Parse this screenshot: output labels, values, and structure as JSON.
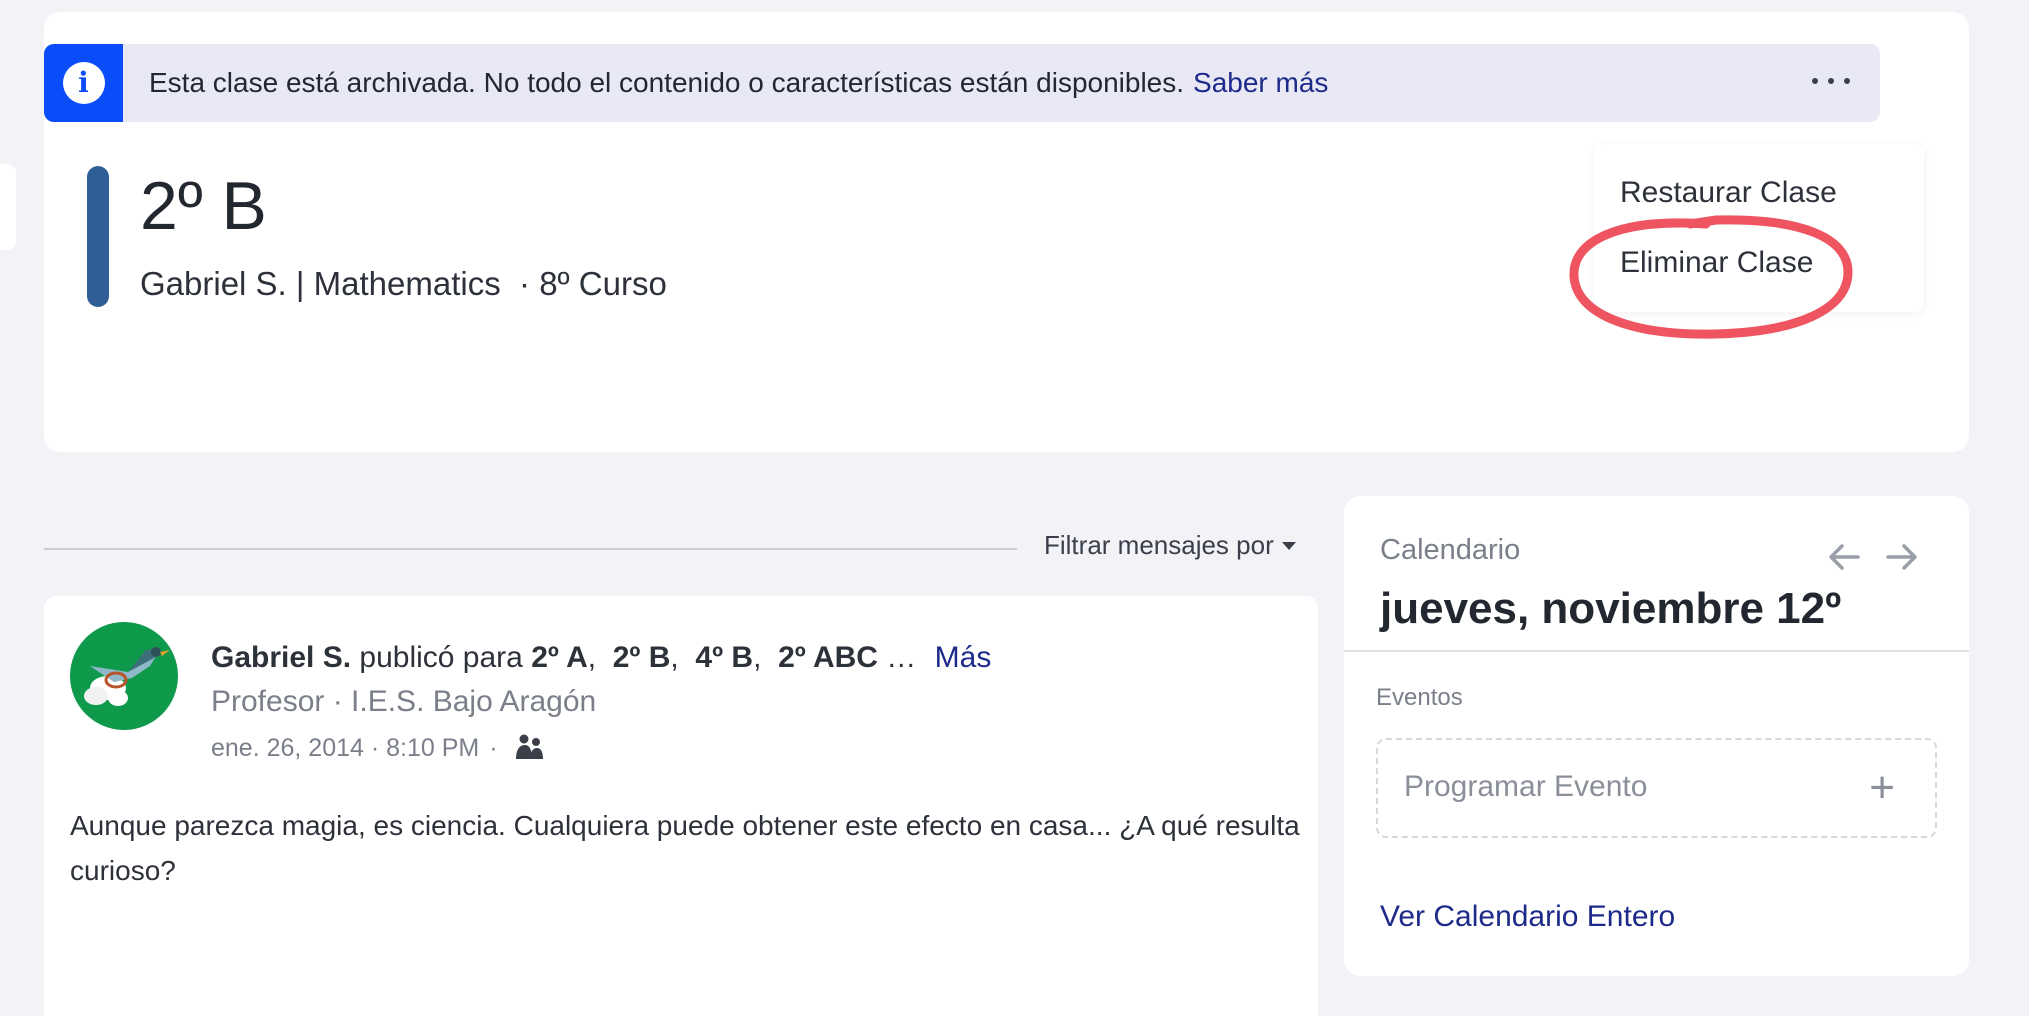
{
  "banner": {
    "message": "Esta clase está archivada. No todo el contenido o características están disponibles.",
    "link": "Saber más",
    "icon": "info-icon",
    "more_icon": "ellipsis-icon"
  },
  "class_info": {
    "title": "2º B",
    "subtitle": "Gabriel S. | Mathematics  · 8º Curso",
    "accent_color": "#2f5e96"
  },
  "menu": {
    "items": [
      {
        "label": "Restaurar Clase"
      },
      {
        "label": "Eliminar Clase"
      }
    ],
    "annotation_color": "#ee5560"
  },
  "feed": {
    "filter_label": "Filtrar mensajes por"
  },
  "post": {
    "author": "Gabriel S.",
    "action": "publicó para",
    "recipients": [
      "2º A",
      "2º B",
      "4º B",
      "2º ABC"
    ],
    "ellipsis": "…",
    "more_label": "Más",
    "role": "Profesor · I.E.S. Bajo Aragón",
    "timestamp": "ene. 26, 2014 · 8:10 PM",
    "separator": "·",
    "body": "Aunque parezca magia, es ciencia. Cualquiera puede obtener este efecto en casa... ¿A qué resulta curioso?"
  },
  "calendar": {
    "label": "Calendario",
    "date": "jueves, noviembre 12º",
    "events_label": "Eventos",
    "schedule_label": "Programar Evento",
    "plus_symbol": "+",
    "view_all_label": "Ver Calendario Entero"
  },
  "colors": {
    "brand_blue": "#0a4cf7",
    "link": "#1d2a8a",
    "avatar_bg": "#0f9a4b"
  }
}
